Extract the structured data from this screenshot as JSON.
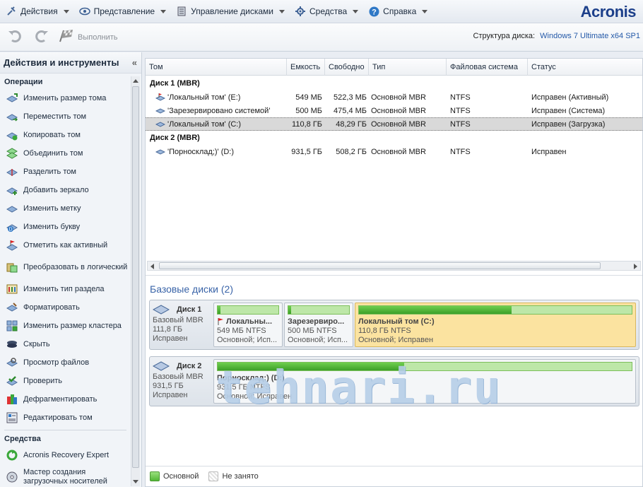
{
  "menu": {
    "items": [
      {
        "label": "Действия",
        "icon": "actions-icon"
      },
      {
        "label": "Представление",
        "icon": "view-icon"
      },
      {
        "label": "Управление дисками",
        "icon": "disk-management-icon"
      },
      {
        "label": "Средства",
        "icon": "tools-icon"
      },
      {
        "label": "Справка",
        "icon": "help-icon"
      }
    ],
    "brand": "Acronis"
  },
  "toolbar": {
    "run_label": "Выполнить",
    "disk_structure_label": "Структура диска:",
    "disk_structure_value": "Windows 7 Ultimate x64 SP1"
  },
  "left_panel": {
    "title": "Действия и инструменты",
    "collapse_glyph": "«",
    "operations_title": "Операции",
    "operations": [
      {
        "label": "Изменить размер тома",
        "icon": "resize-volume-icon"
      },
      {
        "label": "Переместить том",
        "icon": "move-volume-icon"
      },
      {
        "label": "Копировать том",
        "icon": "copy-volume-icon"
      },
      {
        "label": "Объединить том",
        "icon": "merge-volume-icon"
      },
      {
        "label": "Разделить том",
        "icon": "split-volume-icon"
      },
      {
        "label": "Добавить зеркало",
        "icon": "add-mirror-icon"
      },
      {
        "label": "Изменить метку",
        "icon": "change-label-icon"
      },
      {
        "label": "Изменить букву",
        "icon": "change-letter-icon"
      },
      {
        "label": "Отметить как активный",
        "icon": "mark-active-icon"
      },
      {
        "label": "Преобразовать в логический",
        "icon": "convert-logical-icon"
      },
      {
        "label": "Изменить тип раздела",
        "icon": "change-partition-type-icon"
      },
      {
        "label": "Форматировать",
        "icon": "format-icon"
      },
      {
        "label": "Изменить размер кластера",
        "icon": "cluster-size-icon"
      },
      {
        "label": "Скрыть",
        "icon": "hide-icon"
      },
      {
        "label": "Просмотр файлов",
        "icon": "browse-files-icon"
      },
      {
        "label": "Проверить",
        "icon": "check-icon"
      },
      {
        "label": "Дефрагментировать",
        "icon": "defragment-icon"
      },
      {
        "label": "Редактировать том",
        "icon": "edit-volume-icon"
      }
    ],
    "tools_title": "Средства",
    "tools": [
      {
        "label": "Acronis Recovery Expert",
        "icon": "recovery-expert-icon"
      },
      {
        "label": "Мастер создания загрузочных носителей",
        "icon": "bootable-media-icon"
      }
    ]
  },
  "table": {
    "headers": [
      "Том",
      "Емкость",
      "Свободно",
      "Тип",
      "Файловая система",
      "Статус"
    ],
    "disks": [
      {
        "title": "Диск 1 (MBR)",
        "volumes": [
          {
            "name": "'Локальный том' (E:)",
            "capacity": "549 МБ",
            "free": "522,3 МБ",
            "type": "Основной MBR",
            "fs": "NTFS",
            "status": "Исправен (Активный)"
          },
          {
            "name": "'Зарезервировано системой'",
            "capacity": "500 МБ",
            "free": "475,4 МБ",
            "type": "Основной MBR",
            "fs": "NTFS",
            "status": "Исправен (Система)"
          },
          {
            "name": "'Локальный том' (C:)",
            "capacity": "110,8 ГБ",
            "free": "48,29 ГБ",
            "type": "Основной MBR",
            "fs": "NTFS",
            "status": "Исправен (Загрузка)"
          }
        ]
      },
      {
        "title": "Диск 2 (MBR)",
        "volumes": [
          {
            "name": "'Порносклад;)' (D:)",
            "capacity": "931,5 ГБ",
            "free": "508,2 ГБ",
            "type": "Основной MBR",
            "fs": "NTFS",
            "status": "Исправен"
          }
        ]
      }
    ],
    "selected_row": "'Локальный том' (C:)"
  },
  "basic_disks": {
    "title": "Базовые диски (2)",
    "disks": [
      {
        "name": "Диск 1",
        "kind": "Базовый MBR",
        "size": "111,8 ГБ",
        "state": "Исправен",
        "partitions": [
          {
            "name": "Локальны...",
            "size": "549 МБ NTFS",
            "info": "Основной; Исп...",
            "used_fraction": 0.05,
            "active": false,
            "flag": true
          },
          {
            "name": "Зарезервиро...",
            "size": "500 МБ NTFS",
            "info": "Основной; Исп...",
            "used_fraction": 0.05,
            "active": false,
            "flag": false
          },
          {
            "name": "Локальный том (C:)",
            "size": "110,8 ГБ NTFS",
            "info": "Основной; Исправен",
            "used_fraction": 0.56,
            "active": true,
            "flag": false
          }
        ]
      },
      {
        "name": "Диск 2",
        "kind": "Базовый MBR",
        "size": "931,5 ГБ",
        "state": "Исправен",
        "partitions": [
          {
            "name": "Порносклад;) (D:)",
            "size": "931,5 ГБ NTFS",
            "info": "Основной; Исправен",
            "used_fraction": 0.45,
            "active": false,
            "flag": false
          }
        ]
      }
    ]
  },
  "legend": {
    "primary": "Основной",
    "unallocated": "Не занято"
  },
  "watermark": "tehnari.ru",
  "colors": {
    "brand": "#1c3f8a",
    "link": "#2459a8",
    "selected_row": "#d9d9d9",
    "active_partition": "#fbe3a0",
    "used_fill": "#3c9f28"
  }
}
